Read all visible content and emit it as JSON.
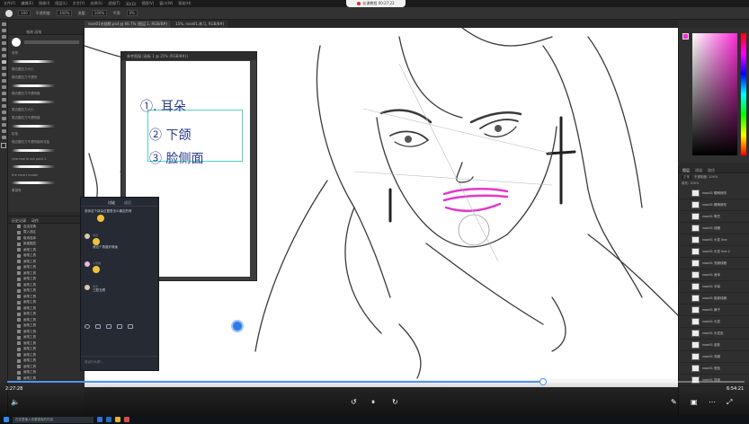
{
  "recording": {
    "label": "长课教程  00:27:22"
  },
  "menu": [
    "文件(F)",
    "编辑(E)",
    "图像(I)",
    "图层(L)",
    "文字(Y)",
    "选择(S)",
    "滤镜(T)",
    "3D(D)",
    "视图(V)",
    "窗口(W)",
    "帮助(H)"
  ],
  "options": {
    "size": "100",
    "opacity_label": "不透明度:",
    "opacity": "100%",
    "flow_label": "流量:",
    "flow": "100%",
    "smooth_label": "平滑:",
    "smooth": "0%"
  },
  "doc_tabs": [
    "rose01夹翅膀.psd @ 66.7% (图层 1, RGB/8#)",
    "15%, rose01.练习, RGB/8#)"
  ],
  "brush_panel": {
    "header": "笔刷 画笔",
    "brushes": [
      "常规",
      "硬边圆压力大小",
      "硬边圆压力不透明",
      "硬边圆压力不透明度",
      "柔边圆压力大小",
      "柔边圆压力不透明度",
      "铅笔",
      "硬边圆压力不透明度和流量",
      "charcoal brush pack 2",
      "the smart model",
      "素描笔"
    ]
  },
  "history_panel": {
    "tabs": [
      "历史记录",
      "动作"
    ],
    "items": [
      "自由变换",
      "载入选区",
      "取消选择",
      "新建图层",
      "画笔工具",
      "画笔工具",
      "画笔工具",
      "画笔工具",
      "画笔工具",
      "画笔工具",
      "画笔工具",
      "画笔工具",
      "画笔工具",
      "画笔工具",
      "画笔工具",
      "画笔工具",
      "画笔工具",
      "画笔工具",
      "画笔工具",
      "画笔工具",
      "画笔工具",
      "画笔工具",
      "画笔工具",
      "画笔工具",
      "画笔工具",
      "画笔工具",
      "画笔工具"
    ]
  },
  "reference_window": {
    "title": "参考图窗 (画板 1 @ 25% (RGB/8#))",
    "notes": [
      "①. 耳朵",
      "② 下颌",
      "③ 脸侧面"
    ]
  },
  "chat": {
    "tabs": [
      "讨论",
      "成员"
    ],
    "messages": [
      {
        "name": "",
        "text": "老师这个耳朵位置是怎么确定的呀"
      },
      {
        "name": "学员",
        "text": "我这个角度好难画"
      },
      {
        "name": "小熊猫",
        "text": ""
      },
      {
        "name": "学员",
        "text": "三庭五眼"
      }
    ],
    "input_placeholder": "说点什么吧..."
  },
  "color_panel": {
    "foreground": "#ff2bd6",
    "accent": "#ff2bd6"
  },
  "layers_panel": {
    "tabs": [
      "图层",
      "通道",
      "路径"
    ],
    "blend_mode": "正常",
    "opacity": "不透明度: 100%",
    "fill": "填充: 100%",
    "layers": [
      "rose01 眼睛修改",
      "rose01 眼睛修改",
      "rose01 嘴巴",
      "rose01 线稿",
      "rose01 头发 line",
      "rose01 头发 line 2",
      "rose01 衣服线稿",
      "rose01 身体",
      "rose01 手臂",
      "rose01 脸部线稿",
      "rose01 脖子",
      "rose01 头发",
      "rose01 头发色",
      "rose01 皮肤",
      "rose01 衣服",
      "rose01 底色",
      "rose01 背景"
    ]
  },
  "video": {
    "current": "2:27:28",
    "total": "6:54:21",
    "progress": 0.7268
  },
  "taskbar": {
    "search_placeholder": "在这里输入你要搜索的内容"
  }
}
